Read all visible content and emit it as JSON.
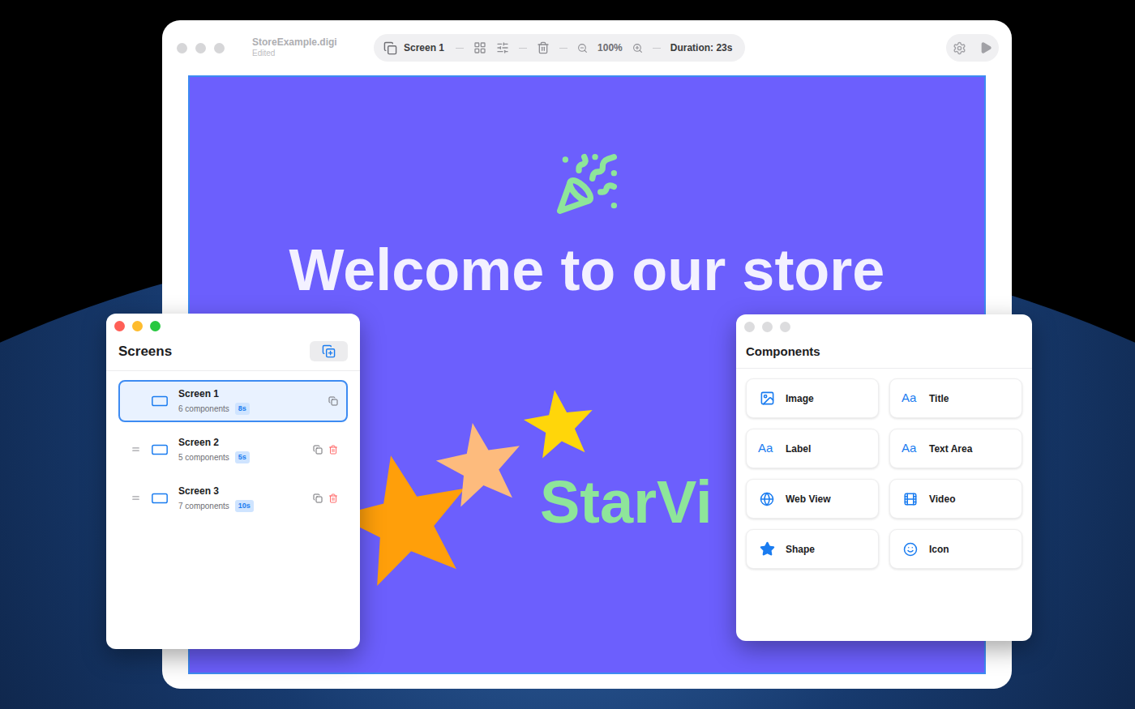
{
  "main_window": {
    "title": "StoreExample.digi",
    "subtitle": "Edited",
    "screen_menu": "Screen 1",
    "zoom": "100%",
    "duration": "Duration: 23s"
  },
  "canvas": {
    "heading": "Welcome to our store",
    "brand": "StarVi"
  },
  "screens_panel": {
    "title": "Screens",
    "items": [
      {
        "name": "Screen 1",
        "components": "6 components",
        "duration": "8s",
        "selected": true,
        "deletable": false
      },
      {
        "name": "Screen 2",
        "components": "5 components",
        "duration": "5s",
        "selected": false,
        "deletable": true
      },
      {
        "name": "Screen 3",
        "components": "7 components",
        "duration": "10s",
        "selected": false,
        "deletable": true
      }
    ]
  },
  "components_panel": {
    "title": "Components",
    "items": [
      {
        "label": "Image",
        "kind": "image"
      },
      {
        "label": "Title",
        "kind": "text",
        "glyph": "Aa"
      },
      {
        "label": "Label",
        "kind": "text",
        "glyph": "Aa"
      },
      {
        "label": "Text Area",
        "kind": "text",
        "glyph": "Aa"
      },
      {
        "label": "Web View",
        "kind": "web"
      },
      {
        "label": "Video",
        "kind": "video"
      },
      {
        "label": "Shape",
        "kind": "shape"
      },
      {
        "label": "Icon",
        "kind": "icon"
      }
    ]
  }
}
